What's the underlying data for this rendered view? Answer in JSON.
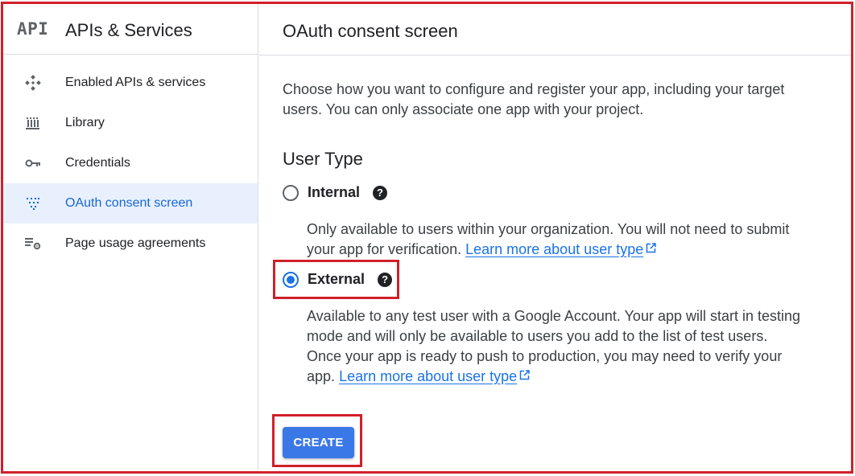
{
  "sidebar": {
    "logo": "API",
    "title": "APIs & Services",
    "items": [
      {
        "label": "Enabled APIs & services",
        "icon": "diamond-dots-icon",
        "active": false
      },
      {
        "label": "Library",
        "icon": "library-icon",
        "active": false
      },
      {
        "label": "Credentials",
        "icon": "key-icon",
        "active": false
      },
      {
        "label": "OAuth consent screen",
        "icon": "consent-dots-icon",
        "active": true
      },
      {
        "label": "Page usage agreements",
        "icon": "settings-list-icon",
        "active": false
      }
    ]
  },
  "main": {
    "title": "OAuth consent screen",
    "intro": "Choose how you want to configure and register your app, including your target users. You can only associate one app with your project.",
    "user_type_heading": "User Type",
    "options": [
      {
        "label": "Internal",
        "selected": false,
        "description": "Only available to users within your organization. You will not need to submit your app for verification.",
        "link": "Learn more about user type"
      },
      {
        "label": "External",
        "selected": true,
        "description": "Available to any test user with a Google Account. Your app will start in testing mode and will only be available to users you add to the list of test users. Once your app is ready to push to production, you may need to verify your app.",
        "link": "Learn more about user type"
      }
    ],
    "create_label": "CREATE"
  },
  "colors": {
    "accent": "#1a73e8",
    "button": "#3b78e7",
    "active_bg": "#e8f0fe",
    "highlight_border": "#d0202a"
  }
}
